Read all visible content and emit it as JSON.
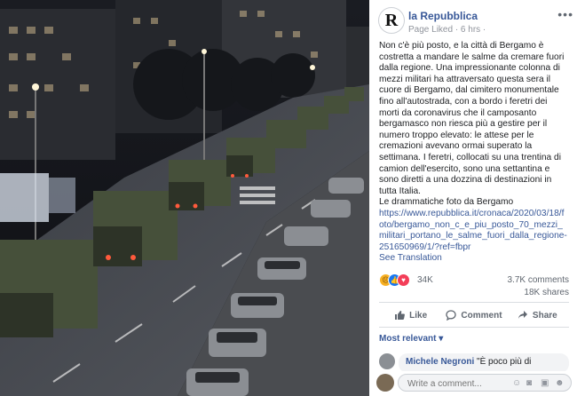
{
  "post": {
    "page_name": "la Repubblica",
    "logo_letter": "R",
    "meta": "Page Liked · 6 hrs ·",
    "more_icon": "ellipsis-icon",
    "text": "Non c'è più posto, e la città di Bergamo è costretta a mandare le salme da cremare fuori dalla regione. Una impressionante colonna di mezzi militari ha attraversato questa sera il cuore di Bergamo, dal cimitero monumentale fino all'autostrada, con a bordo i feretri dei morti da coronavirus che il camposanto bergamasco non riesca più a gestire per il numero troppo elevato: le attese per le cremazioni avevano ormai superato la settimana. I feretri, collocati su una trentina di camion dell'esercito, sono una settantina e sono diretti a una dozzina di destinazioni in tutta Italia.",
    "photo_caption": "Le drammatiche foto da Bergamo",
    "link": "https://www.repubblica.it/cronaca/2020/03/18/foto/bergamo_non_c_e_piu_posto_70_mezzi_militari_portano_le_salme_fuori_dalla_regione-251650969/1/?ref=fbpr",
    "see_translation": "See Translation"
  },
  "stats": {
    "reactions_count": "34K",
    "comments": "3.7K comments",
    "shares": "18K shares"
  },
  "actions": {
    "like": "Like",
    "comment": "Comment",
    "share": "Share"
  },
  "comments_section": {
    "sort_label": "Most relevant ▾",
    "first_comment_author": "Michele Negroni",
    "first_comment_text": "\"È poco più di",
    "write_placeholder": "Write a comment..."
  },
  "colors": {
    "link": "#385898",
    "like": "#1877f2",
    "love": "#f33e58",
    "sad": "#f7b125"
  }
}
